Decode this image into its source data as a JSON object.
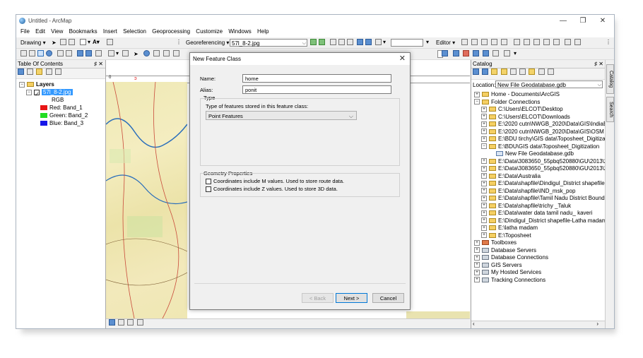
{
  "window": {
    "title": "Untitled - ArcMap",
    "min_glyph": "—",
    "max_glyph": "❐",
    "close_glyph": "✕"
  },
  "menu": [
    "File",
    "Edit",
    "View",
    "Bookmarks",
    "Insert",
    "Selection",
    "Geoprocessing",
    "Customize",
    "Windows",
    "Help"
  ],
  "toolbar": {
    "drawing_label": "Drawing",
    "georef_label": "Georeferencing",
    "georef_layer": "57l_8-2.jpg",
    "editor_label": "Editor",
    "text_a": "A"
  },
  "toc": {
    "title": "Table Of Contents",
    "pin": "♯ ✕",
    "layers_label": "Layers",
    "layer_name": "57l_8-2.jpg",
    "rgb_label": "RGB",
    "bands": [
      {
        "label": "Red:   Band_1",
        "color": "#e81515"
      },
      {
        "label": "Green: Band_2",
        "color": "#22dd22"
      },
      {
        "label": "Blue:  Band_3",
        "color": "#1616e8"
      }
    ]
  },
  "catalog": {
    "title": "Catalog",
    "pin": "♯ ✕",
    "location_label": "Location:",
    "location_value": "New File Geodatabase.gdb",
    "items": [
      {
        "label": "Home - Documents\\ArcGIS",
        "level": 0,
        "type": "folder"
      },
      {
        "label": "Folder Connections",
        "level": 0,
        "type": "folder"
      },
      {
        "label": "C:\\Users\\ELCOT\\Desktop",
        "level": 1,
        "type": "folder"
      },
      {
        "label": "C:\\Users\\ELCOT\\Downloads",
        "level": 1,
        "type": "folder"
      },
      {
        "label": "E:\\2020 cutn\\NWGB_2020\\Data\\GIS\\IndiaBou",
        "level": 1,
        "type": "folder"
      },
      {
        "label": "E:\\2020 cutn\\NWGB_2020\\Data\\GIS\\OSM",
        "level": 1,
        "type": "folder"
      },
      {
        "label": "E:\\BDU tirchy\\GIS data\\Toposheet_Digitizatio",
        "level": 1,
        "type": "folder"
      },
      {
        "label": "E:\\BDU\\GIS data\\Toposheet_Digitization",
        "level": 1,
        "type": "folder"
      },
      {
        "label": "New File Geodatabase.gdb",
        "level": 2,
        "type": "gdb"
      },
      {
        "label": "E:\\Data\\3083650_55pbq520880\\GU\\2013\\201",
        "level": 1,
        "type": "folder"
      },
      {
        "label": "E:\\Data\\3083650_55pbq520880\\GU\\2013\\201",
        "level": 1,
        "type": "folder"
      },
      {
        "label": "E:\\Data\\Australia",
        "level": 1,
        "type": "folder"
      },
      {
        "label": "E:\\Data\\shapfile\\Dindigul_District shapefile-",
        "level": 1,
        "type": "folder"
      },
      {
        "label": "E:\\Data\\shapfile\\IND_msk_pop",
        "level": 1,
        "type": "folder"
      },
      {
        "label": "E:\\Data\\shapfile\\Tamil Nadu District Bound",
        "level": 1,
        "type": "folder"
      },
      {
        "label": "E:\\Data\\shapfile\\trichy _Taluk",
        "level": 1,
        "type": "folder"
      },
      {
        "label": "E:\\Data\\water data tamil nadu_ kaveri",
        "level": 1,
        "type": "folder"
      },
      {
        "label": "E:\\Dindigul_District shapefile-Latha madam",
        "level": 1,
        "type": "folder"
      },
      {
        "label": "E:\\latha madam",
        "level": 1,
        "type": "folder"
      },
      {
        "label": "E:\\Toposheet",
        "level": 1,
        "type": "folder"
      },
      {
        "label": "Toolboxes",
        "level": 0,
        "type": "toolbox"
      },
      {
        "label": "Database Servers",
        "level": 0,
        "type": "server"
      },
      {
        "label": "Database Connections",
        "level": 0,
        "type": "server"
      },
      {
        "label": "GIS Servers",
        "level": 0,
        "type": "server"
      },
      {
        "label": "My Hosted Services",
        "level": 0,
        "type": "server"
      },
      {
        "label": "Tracking Connections",
        "level": 0,
        "type": "server"
      }
    ],
    "side_tabs": [
      "Catalog",
      "Search"
    ]
  },
  "dialog": {
    "title": "New Feature Class",
    "name_label": "Name:",
    "name_value": "home",
    "alias_label": "Alias:",
    "alias_value": "ponit",
    "type_group": "Type",
    "type_prompt": "Type of features stored in this feature class:",
    "type_value": "Point Features",
    "geom_group": "Geometry Properties",
    "check_m": "Coordinates include M values. Used to store route data.",
    "check_z": "Coordinates include Z values. Used to store 3D data.",
    "back": "< Back",
    "next": "Next >",
    "cancel": "Cancel"
  }
}
